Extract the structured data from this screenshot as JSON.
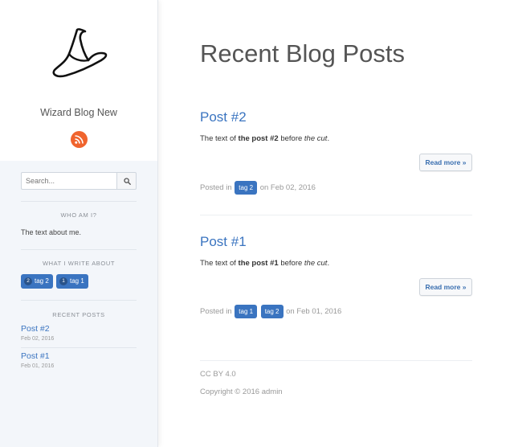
{
  "sidebar": {
    "logo_icon": "wizard-hat-icon",
    "blog_name": "Wizard Blog New",
    "rss_icon": "rss-icon",
    "search": {
      "placeholder": "Search...",
      "button_icon": "search-icon"
    },
    "about": {
      "title": "WHO AM I?",
      "text": "The text about me."
    },
    "tags": {
      "title": "WHAT I WRITE ABOUT",
      "items": [
        {
          "count": "2",
          "label": "tag 2"
        },
        {
          "count": "1",
          "label": "tag 1"
        }
      ]
    },
    "recent": {
      "title": "RECENT POSTS",
      "items": [
        {
          "title": "Post #2",
          "date": "Feb 02, 2016"
        },
        {
          "title": "Post #1",
          "date": "Feb 01, 2016"
        }
      ]
    }
  },
  "main": {
    "title": "Recent Blog Posts",
    "posts": [
      {
        "title": "Post #2",
        "text_pre": "The text of ",
        "text_bold": "the post #2",
        "text_mid": " before ",
        "text_italic": "the cut",
        "text_end": ".",
        "read_more": "Read more",
        "posted_in": "Posted in",
        "tags": [
          "tag 2"
        ],
        "date_text": "on Feb 02, 2016"
      },
      {
        "title": "Post #1",
        "text_pre": "The text of ",
        "text_bold": "the post #1",
        "text_mid": " before ",
        "text_italic": "the cut",
        "text_end": ".",
        "read_more": "Read more",
        "posted_in": "Posted in",
        "tags": [
          "tag 1",
          "tag 2"
        ],
        "date_text": "on Feb 01, 2016"
      }
    ],
    "footer": {
      "license": "CC BY 4.0",
      "copyright": "Copyright © 2016 admin"
    }
  },
  "colors": {
    "accent": "#3a74c0",
    "rss": "#f0642d",
    "sidebar_bg": "#f3f6fa"
  }
}
